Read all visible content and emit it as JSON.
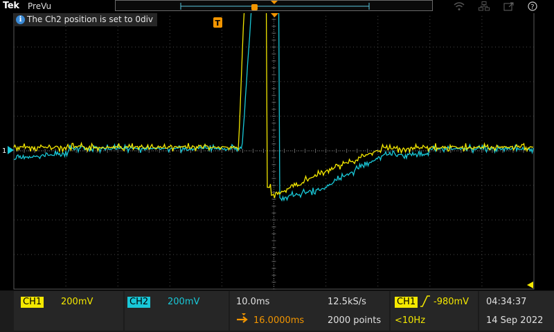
{
  "app": {
    "brand": "Tek",
    "name": "PreVu"
  },
  "toast": {
    "text": "The Ch2 position is set to 0div"
  },
  "markers": {
    "trigger_label": "T",
    "ch_marker_label": "1"
  },
  "channels": {
    "ch1": {
      "label": "CH1",
      "scale": "200mV",
      "color": "#f4e800"
    },
    "ch2": {
      "label": "CH2",
      "scale": "200mV",
      "color": "#19c8d8"
    }
  },
  "horizontal": {
    "timebase": "10.0ms",
    "sample_rate": "12.5kS/s",
    "delay": "16.0000ms",
    "record_length": "2000 points"
  },
  "trigger": {
    "source": "CH1",
    "level": "-980mV",
    "frequency": "<10Hz",
    "slope_icon": "rising-edge-icon"
  },
  "datetime": {
    "time": "04:34:37",
    "date": "14 Sep 2022"
  },
  "icons": [
    "wifi-icon",
    "network-icon",
    "export-icon",
    "help-icon"
  ]
}
